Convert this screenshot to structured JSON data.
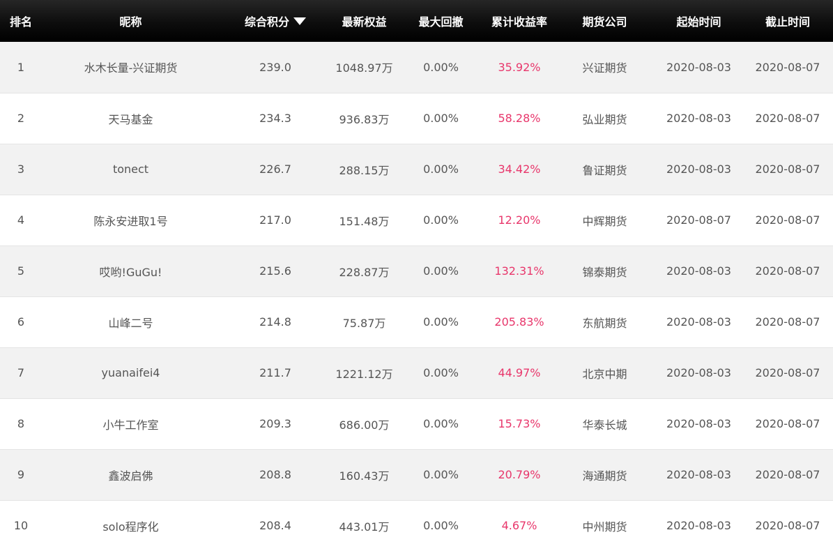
{
  "accent_color": "#e8366b",
  "header_bg": "#000000",
  "headers": {
    "rank": "排名",
    "nickname": "昵称",
    "score": "综合积分",
    "equity": "最新权益",
    "drawdown": "最大回撤",
    "return": "累计收益率",
    "broker": "期货公司",
    "start": "起始时间",
    "end": "截止时间"
  },
  "sort": {
    "column": "score",
    "direction": "desc",
    "icon": "triangle-down-icon"
  },
  "rows": [
    {
      "rank": "1",
      "nickname": "水木长量-兴证期货",
      "score": "239.0",
      "equity": "1048.97万",
      "drawdown": "0.00%",
      "return": "35.92%",
      "broker": "兴证期货",
      "start": "2020-08-03",
      "end": "2020-08-07"
    },
    {
      "rank": "2",
      "nickname": "天马基金",
      "score": "234.3",
      "equity": "936.83万",
      "drawdown": "0.00%",
      "return": "58.28%",
      "broker": "弘业期货",
      "start": "2020-08-03",
      "end": "2020-08-07"
    },
    {
      "rank": "3",
      "nickname": "tonect",
      "score": "226.7",
      "equity": "288.15万",
      "drawdown": "0.00%",
      "return": "34.42%",
      "broker": "鲁证期货",
      "start": "2020-08-03",
      "end": "2020-08-07"
    },
    {
      "rank": "4",
      "nickname": "陈永安进取1号",
      "score": "217.0",
      "equity": "151.48万",
      "drawdown": "0.00%",
      "return": "12.20%",
      "broker": "中辉期货",
      "start": "2020-08-07",
      "end": "2020-08-07"
    },
    {
      "rank": "5",
      "nickname": "哎哟!GuGu!",
      "score": "215.6",
      "equity": "228.87万",
      "drawdown": "0.00%",
      "return": "132.31%",
      "broker": "锦泰期货",
      "start": "2020-08-03",
      "end": "2020-08-07"
    },
    {
      "rank": "6",
      "nickname": "山峰二号",
      "score": "214.8",
      "equity": "75.87万",
      "drawdown": "0.00%",
      "return": "205.83%",
      "broker": "东航期货",
      "start": "2020-08-03",
      "end": "2020-08-07"
    },
    {
      "rank": "7",
      "nickname": "yuanaifei4",
      "score": "211.7",
      "equity": "1221.12万",
      "drawdown": "0.00%",
      "return": "44.97%",
      "broker": "北京中期",
      "start": "2020-08-03",
      "end": "2020-08-07"
    },
    {
      "rank": "8",
      "nickname": "小牛工作室",
      "score": "209.3",
      "equity": "686.00万",
      "drawdown": "0.00%",
      "return": "15.73%",
      "broker": "华泰长城",
      "start": "2020-08-03",
      "end": "2020-08-07"
    },
    {
      "rank": "9",
      "nickname": "鑫波启佛",
      "score": "208.8",
      "equity": "160.43万",
      "drawdown": "0.00%",
      "return": "20.79%",
      "broker": "海通期货",
      "start": "2020-08-03",
      "end": "2020-08-07"
    },
    {
      "rank": "10",
      "nickname": "solo程序化",
      "score": "208.4",
      "equity": "443.01万",
      "drawdown": "0.00%",
      "return": "4.67%",
      "broker": "中州期货",
      "start": "2020-08-03",
      "end": "2020-08-07"
    }
  ]
}
